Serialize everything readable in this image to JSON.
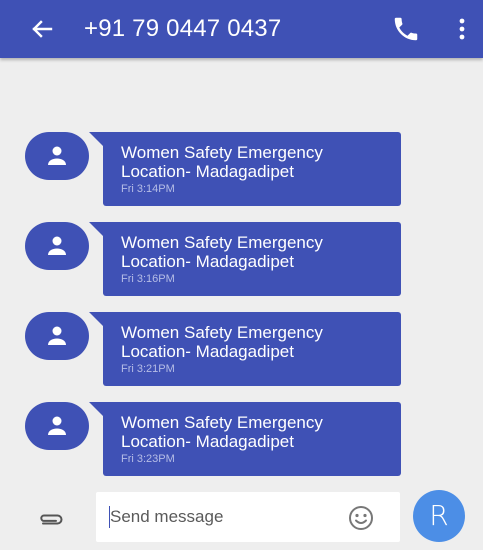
{
  "app_bar": {
    "title": "+91 79 0447 0437",
    "back_icon": "arrow-back-icon",
    "call_icon": "phone-icon",
    "more_icon": "more-vert-icon",
    "color": "#3f51b5"
  },
  "messages": [
    {
      "text": "Women Safety Emergency Location- Madagadipet",
      "time": "Fri 3:14PM"
    },
    {
      "text": "Women Safety Emergency Location- Madagadipet",
      "time": "Fri 3:16PM"
    },
    {
      "text": "Women Safety Emergency Location- Madagadipet",
      "time": "Fri 3:21PM"
    },
    {
      "text": "Women Safety Emergency Location- Madagadipet",
      "time": "Fri 3:23PM"
    }
  ],
  "compose": {
    "placeholder": "Send message",
    "attach_icon": "paperclip-icon",
    "emoji_icon": "smiley-icon",
    "send_label": "R",
    "send_color": "#4c8ee6"
  }
}
